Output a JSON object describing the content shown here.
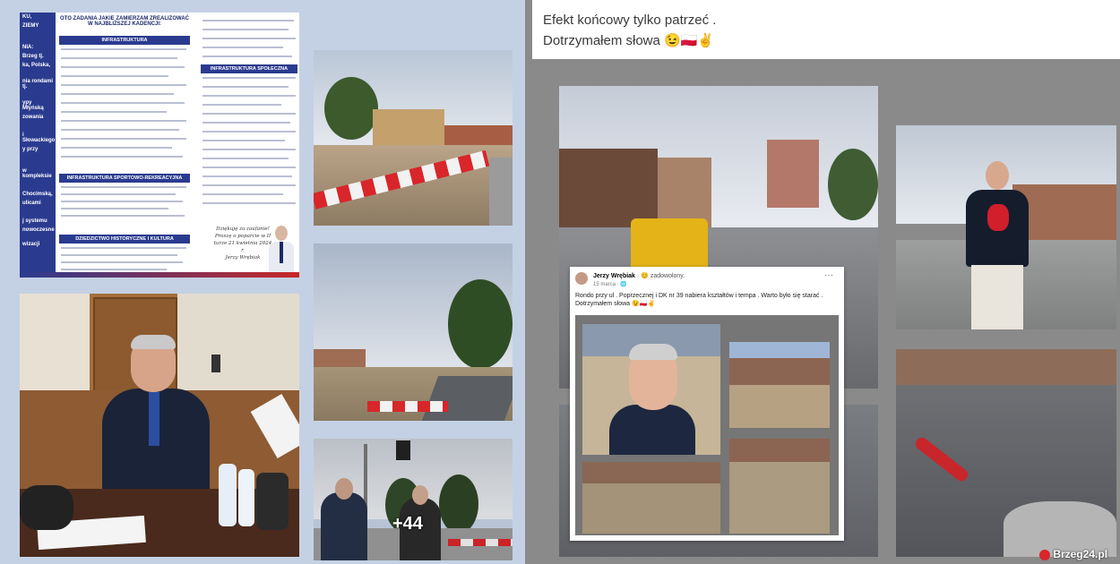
{
  "brochure": {
    "sidebar_lines": [
      "KU,",
      "ZIEMY",
      "NIA:",
      "Brzeg tj.",
      "ka, Polska,",
      "nia rondami tj.",
      "ypy Młyńską",
      "zowania",
      "i Słowackiego",
      "y przy",
      "w kompleksie",
      "Chocimską,",
      "ulicami",
      "j systemu",
      "nowoczesne",
      "wizacji"
    ],
    "heading": "OTO ZADANIA JAKIE ZAMIERZAM ZREALIZOWAĆ W NAJBLIŻSZEJ KADENCJI:",
    "sec_infra": "INFRASTRUKTURA",
    "sec_sport": "INFRASTRUKTURA SPORTOWO-REKREACYJNA",
    "sec_heritage": "DZIEDZICTWO HISTORYCZNE I KULTURA",
    "sec_social": "INFRASTRUKTURA SPOŁECZNA",
    "thanks": "Dziękuję za zaufanie! Proszę o poparcie w II turze 21 kwietnia 2024 r.",
    "signature": "Jerzy Wrębiak"
  },
  "middle": {
    "more_count": "+44"
  },
  "fb_post": {
    "line1": "Efekt końcowy tylko patrzeć .",
    "line2": "Dotrzymałem słowa 😉🇵🇱✌"
  },
  "fb_card": {
    "author": "Jerzy Wrębiak",
    "feeling": "· 😊 zadowolony.",
    "date": "15 marca · 🌐",
    "menu": "···",
    "text": "Rondo przy ul . Poprzecznej i DK nr 39 nabiera kształtów i tempa . Warto było się starać . Dotrzymałem słowa 😉🇵🇱✌"
  },
  "watermark": "Brzeg24.pl",
  "colors": {
    "brand_blue": "#2a3b8f",
    "barrier_red": "#d8262a",
    "fb_gray": "#8a8a8a"
  }
}
